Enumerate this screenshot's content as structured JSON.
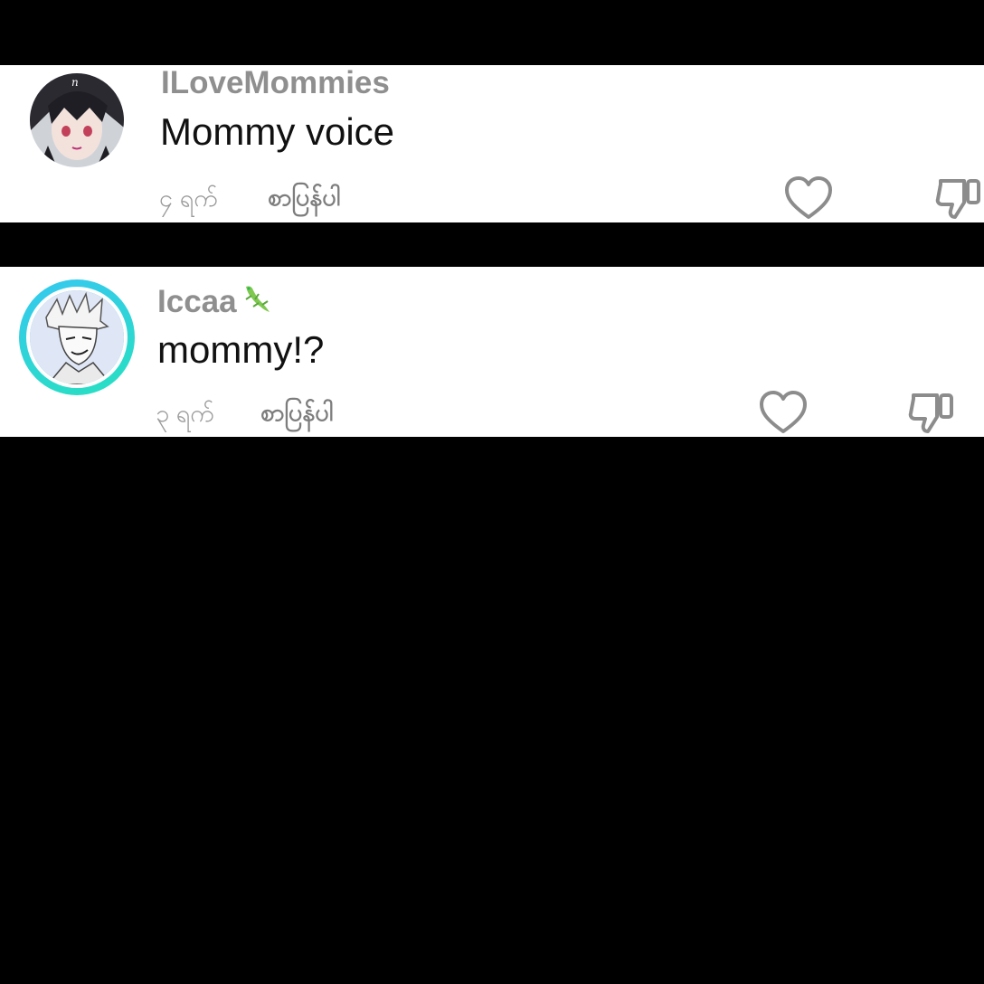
{
  "comments": [
    {
      "username": "ILoveMommies",
      "text": "Mommy voice",
      "time": "၄ ရက်",
      "reply_label": "စာပြန်ပါ",
      "avatar_icon": "anime-girl-avatar"
    },
    {
      "username": "Iccaa",
      "username_emoji": "lizard-icon",
      "text": "mommy!?",
      "time": "၃ ရက်",
      "reply_label": "စာပြန်ပါ",
      "avatar_icon": "anime-boy-avatar",
      "avatar_ring_colors": [
        "#36c8f0",
        "#28e0c0"
      ]
    }
  ],
  "colors": {
    "background": "#000000",
    "card": "#ffffff",
    "username": "#8f8f8f",
    "comment_text": "#111111",
    "icon_stroke": "#8c8c8c"
  }
}
